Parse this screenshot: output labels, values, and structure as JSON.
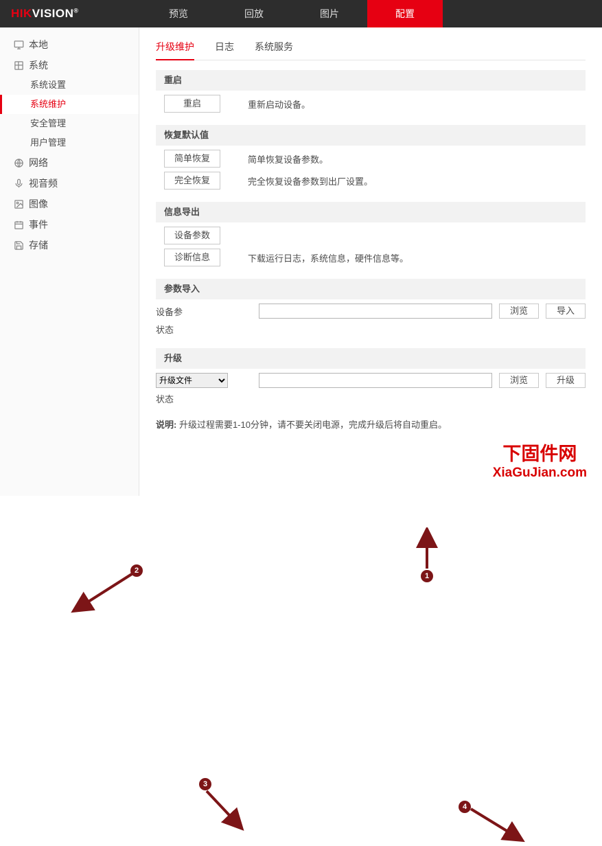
{
  "brand": {
    "hik": "HIK",
    "vision": "VISION",
    "r": "®"
  },
  "topnav": {
    "preview": "预览",
    "playback": "回放",
    "picture": "图片",
    "config": "配置"
  },
  "sidebar": {
    "local": "本地",
    "system": "系统",
    "system_subs": {
      "settings": "系统设置",
      "maint": "系统维护",
      "security": "安全管理",
      "user": "用户管理"
    },
    "network": "网络",
    "av": "视音频",
    "image": "图像",
    "event": "事件",
    "storage": "存储"
  },
  "subtabs": {
    "maint": "升级维护",
    "log": "日志",
    "service": "系统服务"
  },
  "sections": {
    "reboot": {
      "title": "重启",
      "btn": "重启",
      "desc": "重新启动设备。"
    },
    "restore": {
      "title": "恢复默认值",
      "simple_btn": "简单恢复",
      "simple_desc": "简单恢复设备参数。",
      "full_btn": "完全恢复",
      "full_desc": "完全恢复设备参数到出厂设置。"
    },
    "export": {
      "title": "信息导出",
      "param_btn": "设备参数",
      "diag_btn": "诊断信息",
      "diag_desc": "下载运行日志，系统信息，硬件信息等。"
    },
    "import": {
      "title": "参数导入",
      "label": "设备参",
      "status_label": "状态",
      "browse": "浏览",
      "import_btn": "导入"
    },
    "upgrade": {
      "title": "升级",
      "select_opt": "升级文件",
      "status_label": "状态",
      "browse": "浏览",
      "upgrade_btn": "升级"
    }
  },
  "note": {
    "prefix": "说明:",
    "text": " 升级过程需要1-10分钟，请不要关闭电源，完成升级后将自动重启。"
  },
  "annotations": {
    "1": "1",
    "2": "2",
    "3": "3",
    "4": "4"
  },
  "watermark": {
    "cn": "下固件网",
    "en": "XiaGuJian.com"
  }
}
